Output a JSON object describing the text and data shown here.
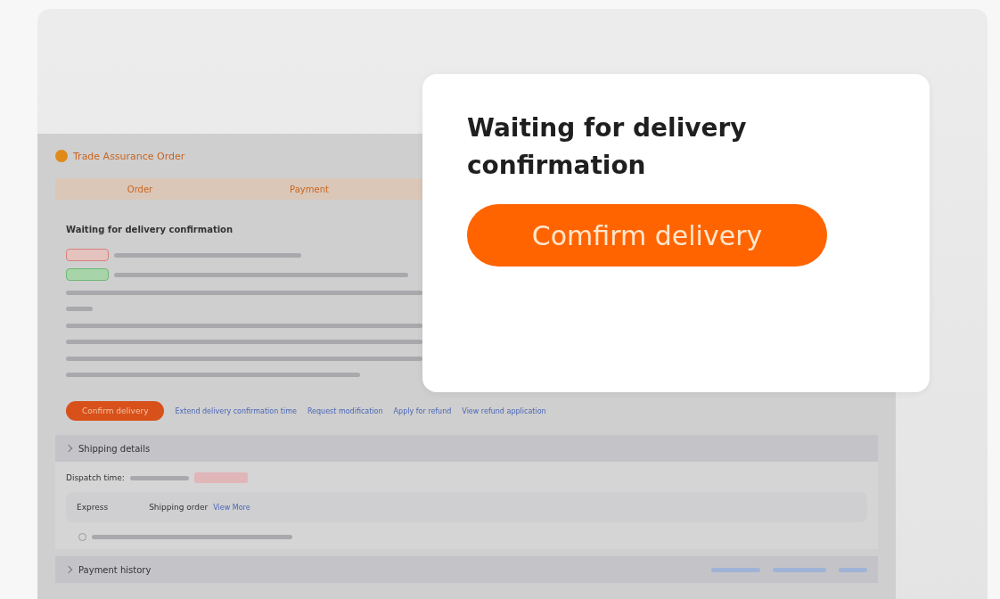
{
  "order_page": {
    "title": "Trade Assurance Order",
    "steps": [
      "Order",
      "Payment"
    ],
    "status_title": "Waiting for delivery confirmation",
    "primary_action": "Confirm delivery",
    "links": [
      "Extend delivery confirmation time",
      "Request modification",
      "Apply for refund",
      "View refund application"
    ],
    "shipping": {
      "title": "Shipping details",
      "dispatch_label": "Dispatch time:",
      "carrier": "Express",
      "order_label": "Shipping order",
      "order_link": "View More"
    },
    "payment": {
      "title": "Payment history"
    }
  },
  "callout": {
    "title": "Waiting for delivery confirmation",
    "button": "Comfirm delivery"
  }
}
